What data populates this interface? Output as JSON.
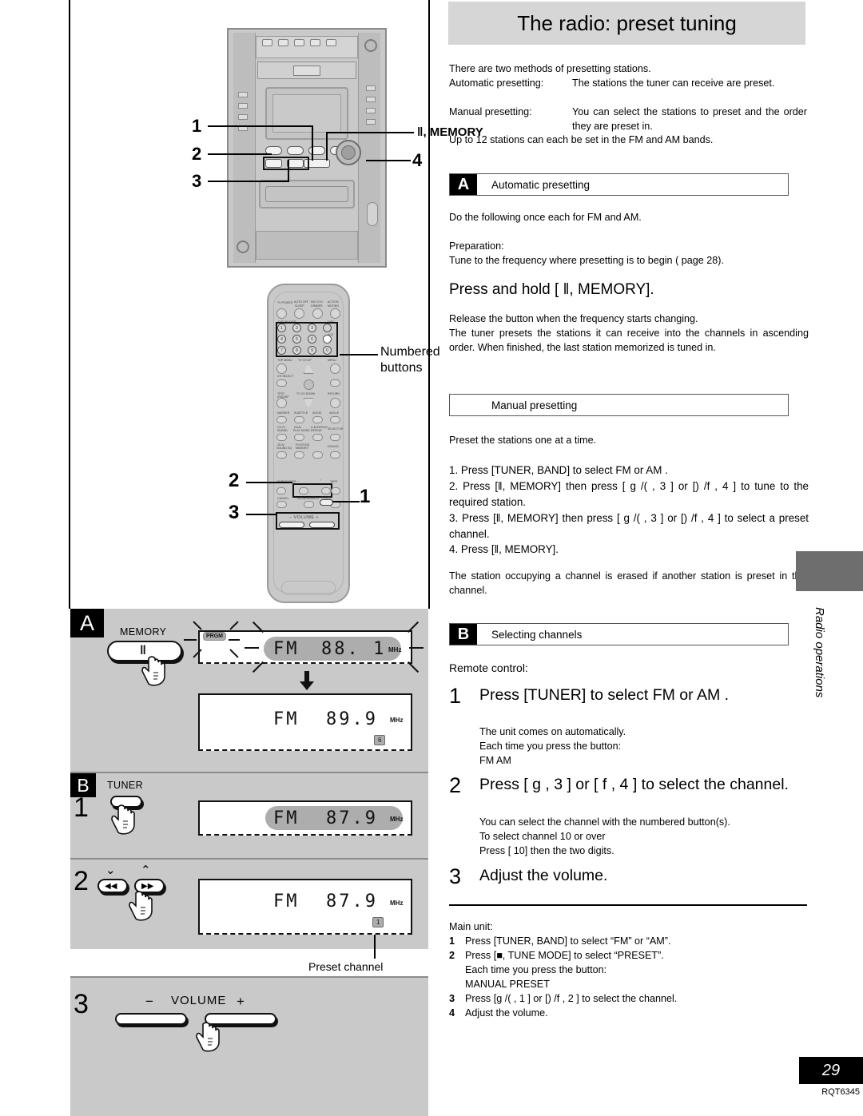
{
  "page": {
    "number": "29",
    "doc_code": "RQT6345",
    "side_tab_label": "Radio operations"
  },
  "header": {
    "title": "The radio: preset tuning"
  },
  "intro": {
    "line1": "There are two methods of presetting stations.",
    "auto_label": "Automatic presetting:",
    "auto_text": "The stations the tuner can receive are preset.",
    "manual_label": "Manual presetting:",
    "manual_text": "You can select the stations to preset and the order they are preset in.",
    "line_last": "Up to 12 stations can each be set in the FM and AM bands."
  },
  "section_a": {
    "tag": "A",
    "heading": "Automatic presetting",
    "intro": "Do the following once each for FM and AM.",
    "prep_label": "Preparation:",
    "prep_text": "Tune to the frequency where presetting is to begin (    page 28).",
    "instruction": "Press and hold [ ‖, MEMORY].",
    "note1": "Release the button when the frequency starts changing.",
    "note2": "The tuner presets the stations it can receive into the channels in ascending order. When finished, the last station memorized is tuned in."
  },
  "manual_section": {
    "heading": "Manual presetting",
    "intro": "Preset the stations one at a time.",
    "steps": [
      "1.  Press [TUNER, BAND] to select    FM  or  AM .",
      "2.  Press [‖, MEMORY] then press [ g   /(    , 3 ] or [)   /f   , 4 ] to tune to the required station.",
      "3.  Press [‖, MEMORY] then press [ g   /(    , 3 ] or [)   /f   , 4 ]  to select a preset channel.",
      "4.  Press [‖, MEMORY]."
    ],
    "note": "The station occupying a channel is erased if another station is preset in that channel."
  },
  "section_b": {
    "tag": "B",
    "heading": "Selecting channels",
    "remote_label": "Remote control:",
    "steps": [
      {
        "num": "1",
        "text": "Press [TUNER] to select   FM  or AM .",
        "sub": [
          "The unit comes on automatically.",
          "Each time you press the button:",
          "FM      AM"
        ]
      },
      {
        "num": "2",
        "text": "Press [ g    , 3 ] or [ f    , 4 ] to select the channel.",
        "sub": [
          "You can select the channel with the numbered button(s).",
          "To select channel 10 or over",
          "Press [  10] then the two digits."
        ]
      },
      {
        "num": "3",
        "text": "Adjust the volume.",
        "sub": []
      }
    ]
  },
  "main_unit": {
    "label": "Main unit:",
    "steps": [
      {
        "num": "1",
        "text": "Press [TUNER, BAND] to select “FM” or “AM”.",
        "sub": []
      },
      {
        "num": "2",
        "text": "Press [■, TUNE MODE] to select “PRESET”.",
        "sub": [
          "Each time you press the button:",
          "MANUAL     PRESET"
        ]
      },
      {
        "num": "3",
        "text": "Press [g    /(    , 1 ] or [)    /f    , 2 ] to select the channel.",
        "sub": []
      },
      {
        "num": "4",
        "text": "Adjust the volume.",
        "sub": []
      }
    ]
  },
  "illustrations": {
    "unit_callouts": {
      "n1": "1",
      "n2": "2",
      "n3": "3",
      "n4": "4",
      "memory_label": "‖, MEMORY"
    },
    "remote_callouts": {
      "numbered_buttons_label_l1": "Numbered",
      "numbered_buttons_label_l2": "buttons",
      "n1": "1",
      "n2": "2",
      "n3": "3"
    },
    "remote_keys": {
      "row_top": [
        "TV POWER",
        "AUTO OFF\nSLEEP",
        "MIX 2CH\nDIMMER",
        "ACTION\nMUTING"
      ],
      "numbers": [
        "1",
        "2",
        "3",
        "4",
        "5",
        "6",
        "7",
        "8",
        "9",
        "0"
      ],
      "ten_label": "≧10",
      "disc_label": "DISC",
      "labels": [
        "TOP MENU",
        "TV CH UP",
        "MENU",
        "CH SELECT",
        "TEST\nSU/DISP",
        "TV CH DOWN",
        "RETURN",
        "MARKER",
        "SUBTITLE",
        "AUDIO",
        "ANGLE",
        "CD PL\nSURND",
        "DUAL\nPLAY MODE",
        "A-B REPEAT",
        "SELECTOR",
        "3D AI\nSOUND EQ",
        "POSITION\nMEMORY",
        "DVD/CD",
        "SUBWOOFER",
        "TAPE",
        "SLOW/SEARCH",
        "TUNER"
      ],
      "volume_label": "−  VOLUME  +"
    }
  },
  "figure_a": {
    "tag": "A",
    "button_label": "MEMORY",
    "button_glyph": "‖",
    "prgm": "PRGM",
    "display_1": {
      "band": "FM",
      "freq": "88. 1",
      "unit": "MHz"
    },
    "display_2": {
      "band": "FM",
      "freq": "89.9",
      "unit": "MHz",
      "preset": "6"
    }
  },
  "figure_b": {
    "tag": "B",
    "step1": {
      "num": "1",
      "button_label": "TUNER",
      "display": {
        "band": "FM",
        "freq": "87.9",
        "unit": "MHz"
      }
    },
    "step2": {
      "num": "2",
      "skip_back": "◀◀",
      "skip_fwd": "▶▶",
      "display": {
        "band": "FM",
        "freq": "87.9",
        "unit": "MHz",
        "preset": "1"
      },
      "caption": "Preset channel"
    },
    "step3": {
      "num": "3",
      "volume_label": "VOLUME",
      "minus": "−",
      "plus": "+"
    }
  }
}
